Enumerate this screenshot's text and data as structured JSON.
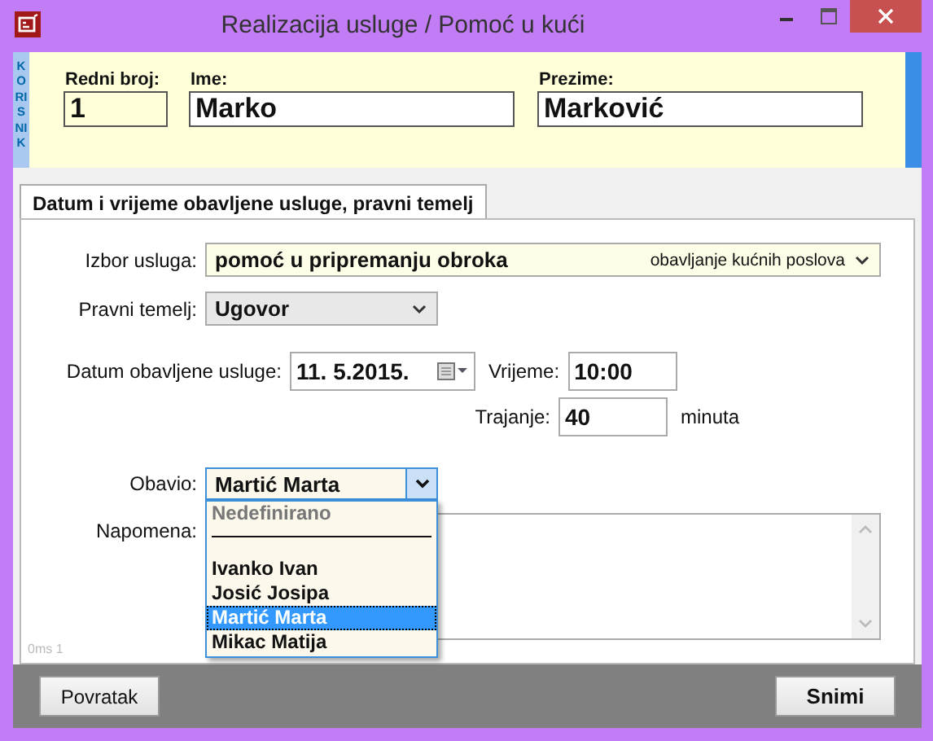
{
  "window": {
    "title": "Realizacija usluge / Pomoć u kući"
  },
  "header": {
    "side_label": "KORISNIK",
    "fields": [
      {
        "label": "Redni broj:",
        "value": "1"
      },
      {
        "label": "Ime:",
        "value": "Marko"
      },
      {
        "label": "Prezime:",
        "value": "Marković"
      }
    ]
  },
  "tabs": [
    {
      "label": "Datum i vrijeme obavljene usluge, pravni temelj",
      "selected": true
    }
  ],
  "form": {
    "service": {
      "label": "Izbor usluga:",
      "value": "pomoć u pripremanju obroka",
      "category": "obavljanje kućnih poslova"
    },
    "legal_basis": {
      "label": "Pravni temelj:",
      "value": "Ugovor"
    },
    "date": {
      "label": "Datum obavljene usluge:",
      "value": "11.  5.2015."
    },
    "time": {
      "label": "Vrijeme:",
      "value": "10:00"
    },
    "duration": {
      "label": "Trajanje:",
      "value": "40",
      "unit": "minuta"
    },
    "performer": {
      "label": "Obavio:",
      "value": "Martić Marta",
      "expanded": true,
      "options": [
        {
          "kind": "placeholder",
          "label": "Nedefinirano",
          "selected": false
        },
        {
          "kind": "separator"
        },
        {
          "kind": "person",
          "label": "Ivanko Ivan",
          "selected": false
        },
        {
          "kind": "person",
          "label": "Josić Josipa",
          "selected": false
        },
        {
          "kind": "person",
          "label": "Martić Marta",
          "selected": true
        },
        {
          "kind": "person",
          "label": "Mikac Matija",
          "selected": false
        }
      ]
    },
    "note": {
      "label": "Napomena:"
    },
    "status_text": "0ms 1"
  },
  "buttons": [
    {
      "label": "Povratak",
      "kind": "normal"
    },
    {
      "label": "Snimi",
      "kind": "primary"
    }
  ]
}
